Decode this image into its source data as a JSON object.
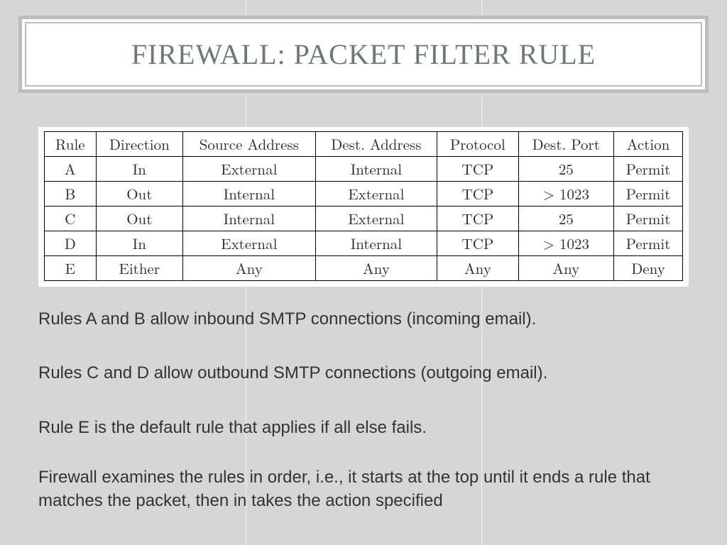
{
  "title": "FIREWALL: PACKET FILTER RULE",
  "table": {
    "headers": [
      "Rule",
      "Direction",
      "Source Address",
      "Dest. Address",
      "Protocol",
      "Dest. Port",
      "Action"
    ],
    "rows": [
      [
        "A",
        "In",
        "External",
        "Internal",
        "TCP",
        "25",
        "Permit"
      ],
      [
        "B",
        "Out",
        "Internal",
        "External",
        "TCP",
        "> 1023",
        "Permit"
      ],
      [
        "C",
        "Out",
        "Internal",
        "External",
        "TCP",
        "25",
        "Permit"
      ],
      [
        "D",
        "In",
        "External",
        "Internal",
        "TCP",
        "> 1023",
        "Permit"
      ],
      [
        "E",
        "Either",
        "Any",
        "Any",
        "Any",
        "Any",
        "Deny"
      ]
    ]
  },
  "bullets": [
    "Rules A and B allow inbound SMTP connections (incoming email).",
    "Rules C and D allow outbound SMTP connections (outgoing email).",
    "Rule E is the default rule that applies if all else fails.",
    "Firewall examines the rules in order, i.e., it starts at the top until it ends a rule that matches the packet, then in takes the action specified"
  ],
  "guides_x": [
    346,
    678
  ]
}
